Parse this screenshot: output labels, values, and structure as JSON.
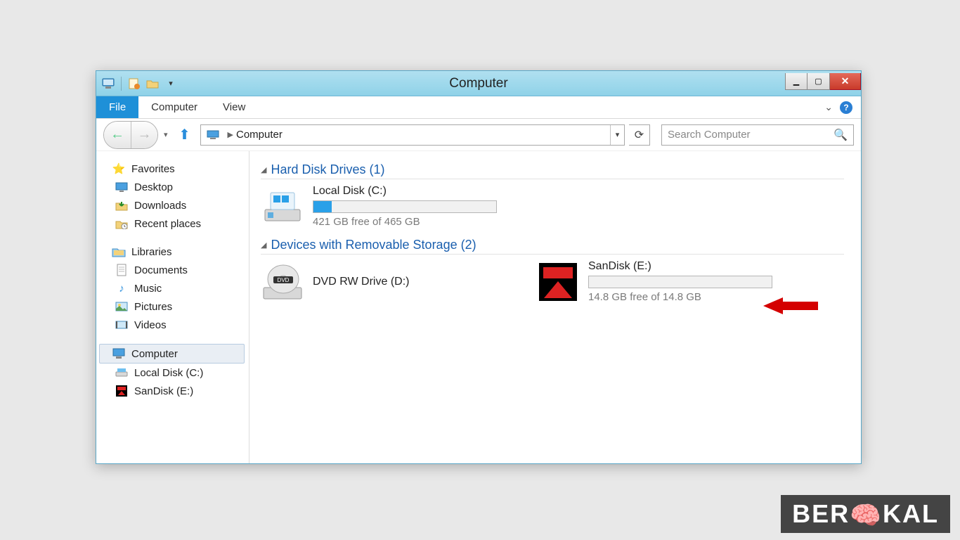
{
  "window": {
    "title": "Computer"
  },
  "ribbon": {
    "file": "File",
    "computer": "Computer",
    "view": "View"
  },
  "nav": {
    "location": "Computer",
    "search_placeholder": "Search Computer"
  },
  "sidebar": {
    "favorites": {
      "label": "Favorites",
      "items": [
        "Desktop",
        "Downloads",
        "Recent places"
      ]
    },
    "libraries": {
      "label": "Libraries",
      "items": [
        "Documents",
        "Music",
        "Pictures",
        "Videos"
      ]
    },
    "computer": {
      "label": "Computer",
      "items": [
        "Local Disk (C:)",
        "SanDisk (E:)"
      ]
    }
  },
  "sections": {
    "hdd": {
      "heading": "Hard Disk Drives (1)"
    },
    "removable": {
      "heading": "Devices with Removable Storage (2)"
    }
  },
  "drives": {
    "c": {
      "name": "Local Disk (C:)",
      "free_text": "421 GB free of 465 GB",
      "fill_percent": 10
    },
    "dvd": {
      "name": "DVD RW Drive (D:)"
    },
    "usb": {
      "name": "SanDisk (E:)",
      "free_text": "14.8 GB free of 14.8 GB",
      "fill_percent": 0
    }
  },
  "watermark": "BERAKAL"
}
